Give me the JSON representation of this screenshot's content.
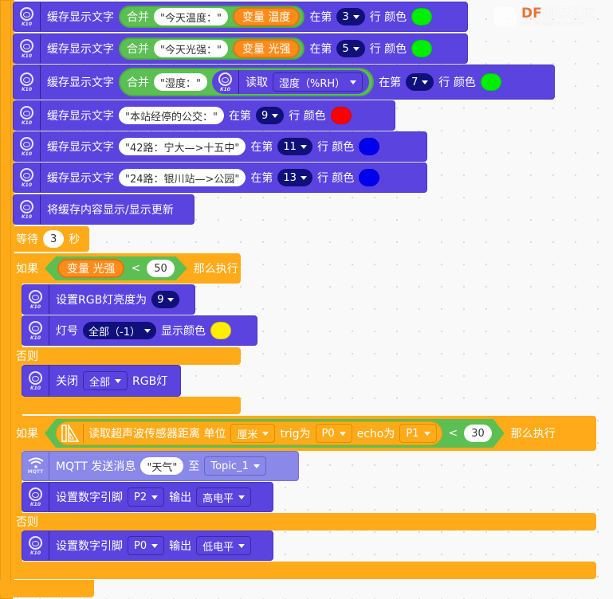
{
  "watermark": {
    "brand_prefix": "DF",
    "brand_suffix": "创客社区",
    "url": "mc.DFRobot.com.cn",
    "accent_color": "#e8763a"
  },
  "icons": {
    "k10": "K10",
    "mqtt": "MQTT"
  },
  "blocks": {
    "cache1": {
      "label": "缓存显示文字",
      "join": "合并",
      "text": "\"今天温度：\"",
      "var": "变量 温度",
      "at": "在第",
      "line": "3",
      "row": "行 颜色",
      "color": "#00ee00"
    },
    "cache2": {
      "label": "缓存显示文字",
      "join": "合并",
      "text": "\"今天光强：\"",
      "var": "变量 光强",
      "at": "在第",
      "line": "5",
      "row": "行 颜色",
      "color": "#00ee00"
    },
    "cache3": {
      "label": "缓存显示文字",
      "join": "合并",
      "text": "\"湿度：\"",
      "read": "读取",
      "sensor": "湿度（%RH）",
      "at": "在第",
      "line": "7",
      "row": "行 颜色",
      "color": "#00ee00"
    },
    "cache4": {
      "label": "缓存显示文字",
      "text": "\"本站经停的公交：\"",
      "at": "在第",
      "line": "9",
      "row": "行 颜色",
      "color": "#ff0000"
    },
    "cache5": {
      "label": "缓存显示文字",
      "text": "\"42路：宁大—>十五中\"",
      "at": "在第",
      "line": "11",
      "row": "行 颜色",
      "color": "#0000ee"
    },
    "cache6": {
      "label": "缓存显示文字",
      "text": "\"24路：银川站—>公园\"",
      "at": "在第",
      "line": "13",
      "row": "行 颜色",
      "color": "#0000ee"
    },
    "refresh": {
      "label": "将缓存内容显示/显示更新"
    },
    "wait": {
      "label": "等待",
      "value": "3",
      "unit": "秒"
    },
    "if1": {
      "if_label": "如果",
      "var": "变量 光强",
      "op": "<",
      "value": "50",
      "then": "那么执行",
      "brightness": {
        "label": "设置RGB灯亮度为",
        "value": "9"
      },
      "lamp": {
        "label": "灯号",
        "which": "全部（-1）",
        "show": "显示颜色",
        "color": "#ffee00"
      },
      "else_label": "否则",
      "off": {
        "label": "关闭",
        "which": "全部",
        "suffix": "RGB灯"
      }
    },
    "if2": {
      "if_label": "如果",
      "sonar": {
        "label": "读取超声波传感器距离 单位",
        "unit": "厘米",
        "trig_label": "trig为",
        "trig": "P0",
        "echo_label": "echo为",
        "echo": "P1"
      },
      "op": "<",
      "value": "30",
      "then": "那么执行",
      "mqtt": {
        "label": "MQTT 发送消息",
        "message": "\"天气\"",
        "to": "至",
        "topic": "Topic_1"
      },
      "pin_high": {
        "label": "设置数字引脚",
        "pin": "P2",
        "out": "输出",
        "level": "高电平"
      },
      "else_label": "否则",
      "pin_low": {
        "label": "设置数字引脚",
        "pin": "P0",
        "out": "输出",
        "level": "低电平"
      }
    }
  }
}
